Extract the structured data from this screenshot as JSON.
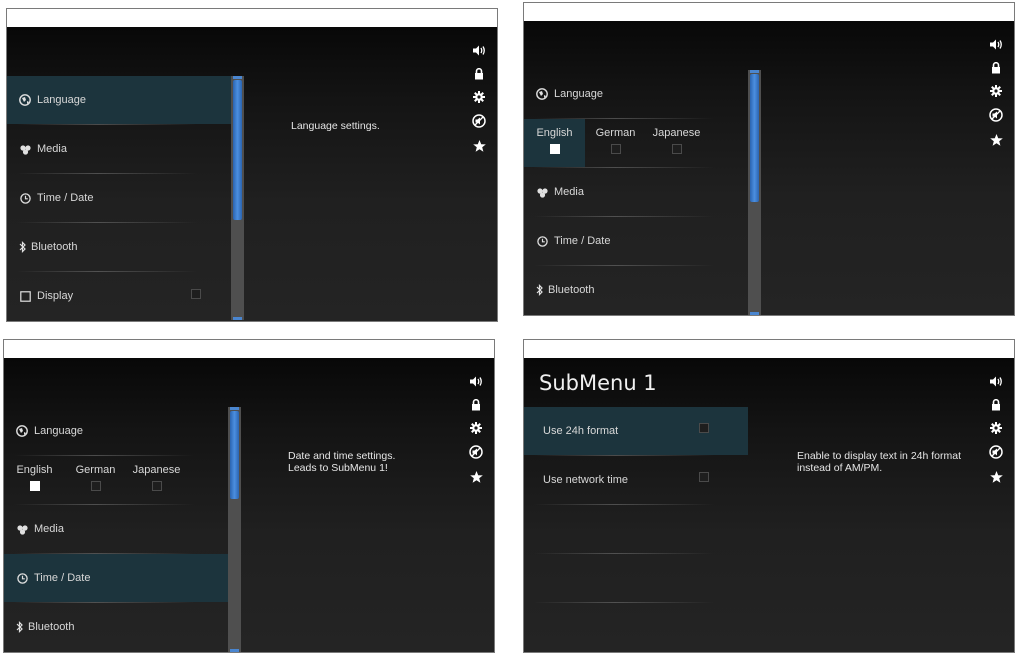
{
  "menu": {
    "language": "Language",
    "media": "Media",
    "time_date": "Time / Date",
    "bluetooth": "Bluetooth",
    "display": "Display"
  },
  "languages": {
    "english": "English",
    "german": "German",
    "japanese": "Japanese"
  },
  "panel1": {
    "description": "Language settings."
  },
  "panel3": {
    "description_line1": "Date and time settings.",
    "description_line2": "Leads to SubMenu 1!"
  },
  "panel4": {
    "title": "SubMenu 1",
    "option_24h": "Use 24h format",
    "option_network": "Use network time",
    "description_line1": "Enable to display text in 24h format",
    "description_line2": "instead of AM/PM."
  },
  "side_icons": [
    "volume-icon",
    "lock-icon",
    "gear-icon",
    "mute-icon",
    "star-icon"
  ],
  "colors": {
    "selection": "#1c343d",
    "scroll_thumb": "#3f80d4",
    "background": "#1a1a1a"
  }
}
